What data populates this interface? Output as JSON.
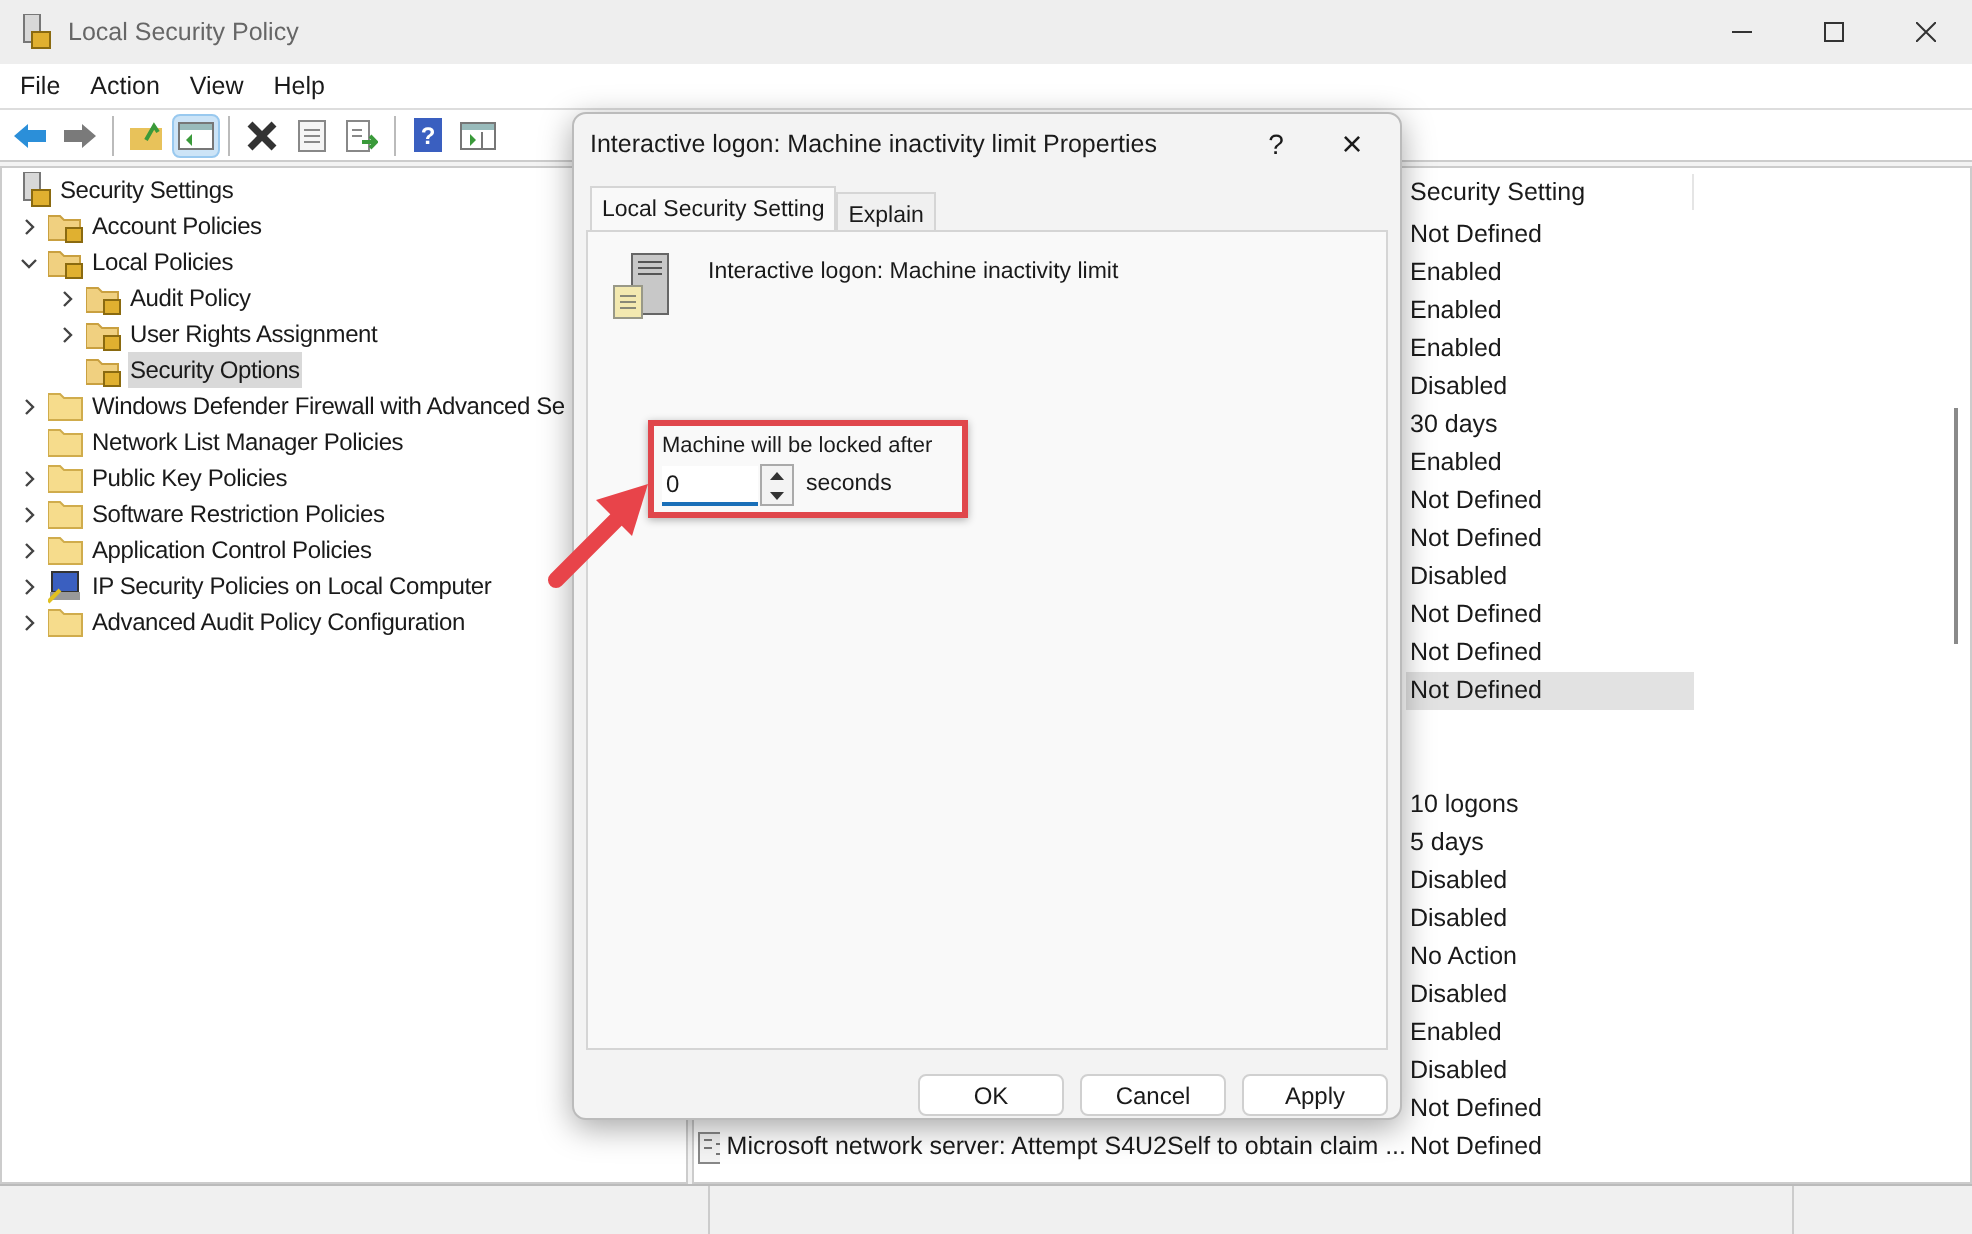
{
  "window": {
    "title": "Local Security Policy"
  },
  "menu": [
    "File",
    "Action",
    "View",
    "Help"
  ],
  "toolbar": [
    {
      "kind": "back"
    },
    {
      "kind": "forward"
    },
    {
      "kind": "sep"
    },
    {
      "kind": "up"
    },
    {
      "kind": "tree",
      "selected": true
    },
    {
      "kind": "sep"
    },
    {
      "kind": "delete"
    },
    {
      "kind": "properties"
    },
    {
      "kind": "export"
    },
    {
      "kind": "sep"
    },
    {
      "kind": "help",
      "glyph": "?"
    },
    {
      "kind": "actionpane"
    }
  ],
  "tree": [
    {
      "label": "Security Settings",
      "selected": false,
      "children": [
        {
          "label": "Account Policies",
          "expanded": false,
          "selected": false
        },
        {
          "label": "Local Policies",
          "expanded": true,
          "selected": false,
          "children": [
            {
              "label": "Audit Policy",
              "expanded": false,
              "selected": false
            },
            {
              "label": "User Rights Assignment",
              "expanded": false,
              "selected": false
            },
            {
              "label": "Security Options",
              "selected": true
            }
          ]
        },
        {
          "label": "Windows Defender Firewall with Advanced Se",
          "expanded": false,
          "selected": false
        },
        {
          "label": "Network List Manager Policies",
          "selected": false
        },
        {
          "label": "Public Key Policies",
          "expanded": false,
          "selected": false
        },
        {
          "label": "Software Restriction Policies",
          "expanded": false,
          "selected": false
        },
        {
          "label": "Application Control Policies",
          "expanded": false,
          "selected": false
        },
        {
          "label": "IP Security Policies on Local Computer",
          "expanded": false,
          "selected": false
        },
        {
          "label": "Advanced Audit Policy Configuration",
          "expanded": false,
          "selected": false
        }
      ]
    }
  ],
  "list": {
    "columns": [
      "Security Setting"
    ],
    "rows": [
      {
        "setting": "Not Defined",
        "selected": false
      },
      {
        "setting": "Enabled",
        "selected": false
      },
      {
        "setting": "Enabled",
        "selected": false
      },
      {
        "setting": "Enabled",
        "selected": false
      },
      {
        "setting": "Disabled",
        "selected": false
      },
      {
        "setting": "30 days",
        "selected": false
      },
      {
        "setting": "Enabled",
        "selected": false
      },
      {
        "setting": "Not Defined",
        "selected": false
      },
      {
        "setting": "Not Defined",
        "selected": false
      },
      {
        "setting": "Disabled",
        "selected": false
      },
      {
        "setting": "Not Defined",
        "selected": false
      },
      {
        "setting": "Not Defined",
        "selected": false
      },
      {
        "setting": "Not Defined",
        "selected": true
      },
      {
        "selected": false
      },
      {
        "selected": false
      },
      {
        "setting": "10 logons",
        "selected": false
      },
      {
        "setting": "5 days",
        "selected": false
      },
      {
        "setting": "Disabled",
        "selected": false
      },
      {
        "setting": "Disabled",
        "selected": false
      },
      {
        "setting": "No Action",
        "selected": false
      },
      {
        "setting": "Disabled",
        "selected": false
      },
      {
        "setting": "Enabled",
        "selected": false
      },
      {
        "setting": "Disabled",
        "selected": false
      },
      {
        "setting": "Not Defined",
        "selected": false
      },
      {
        "policy": "Microsoft network server: Attempt S4U2Self to obtain claim ...",
        "setting": "Not Defined",
        "selected": false
      }
    ]
  },
  "dialog": {
    "title": "Interactive logon: Machine inactivity limit Properties",
    "help": "?",
    "close": "×",
    "tabs": [
      {
        "label": "Local Security Setting",
        "selected": true
      },
      {
        "label": "Explain",
        "selected": false
      }
    ],
    "policy_name": "Interactive logon: Machine inactivity limit",
    "field_label": "Machine will be locked after",
    "value": "0",
    "unit": "seconds",
    "buttons": [
      "OK",
      "Cancel",
      "Apply"
    ]
  }
}
